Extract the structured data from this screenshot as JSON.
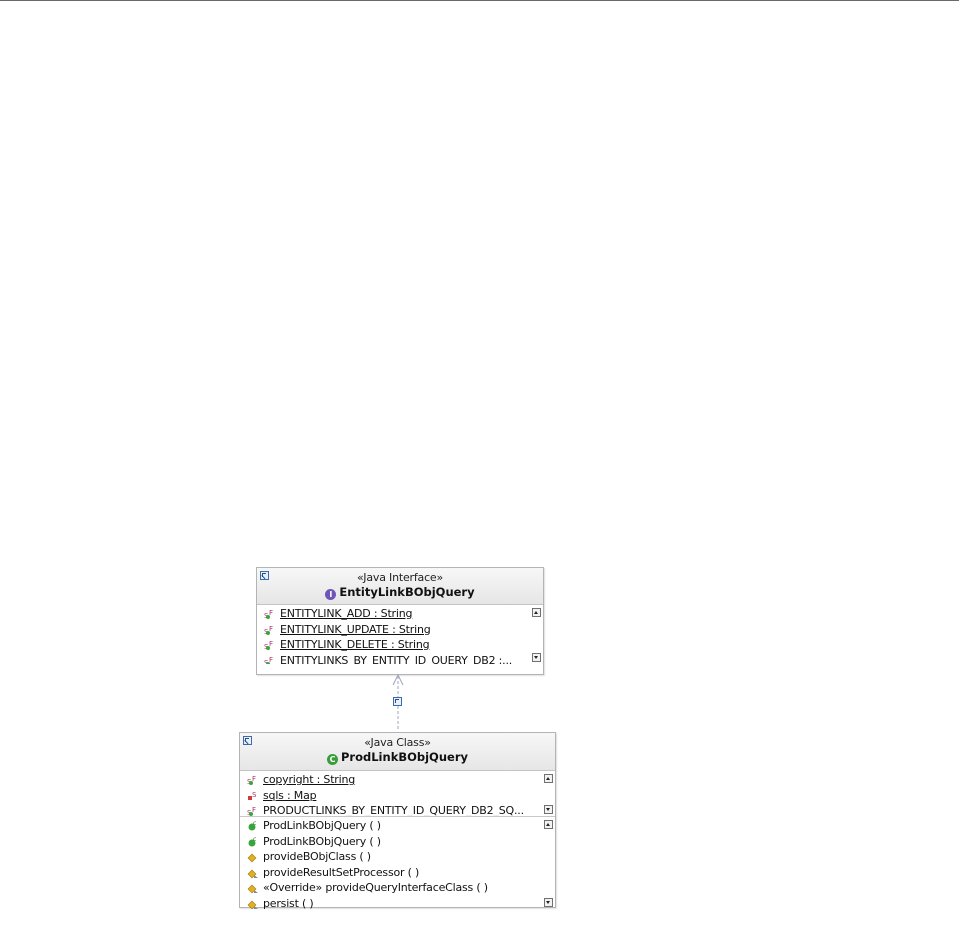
{
  "interface": {
    "stereotype": "«Java Interface»",
    "name": "EntityLinkBObjQuery",
    "badge": "I",
    "fields": [
      {
        "text": "ENTITYLINK_ADD : String",
        "icon": "static-final-field-icon",
        "static": true
      },
      {
        "text": "ENTITYLINK_UPDATE : String",
        "icon": "static-final-field-icon",
        "static": true
      },
      {
        "text": "ENTITYLINK_DELETE : String",
        "icon": "static-final-field-icon",
        "static": true
      },
      {
        "text": "ENTITYLINKS_BY_ENTITY_ID_QUERY_DB2 :...",
        "icon": "static-final-field-icon",
        "static": false
      }
    ]
  },
  "class": {
    "stereotype": "«Java Class»",
    "name": "ProdLinkBObjQuery",
    "badge": "C",
    "fields": [
      {
        "text": "copyright : String",
        "icon": "static-final-field-icon",
        "static": true
      },
      {
        "text": "sqls : Map",
        "icon": "private-static-field-icon",
        "static": true
      },
      {
        "text": "PRODUCTLINKS_BY_ENTITY_ID_QUERY_DB2_SQ...",
        "icon": "static-final-field-icon",
        "static": false
      }
    ],
    "methods": [
      {
        "text": "ProdLinkBObjQuery ( )",
        "icon": "public-constructor-icon"
      },
      {
        "text": "ProdLinkBObjQuery ( )",
        "icon": "public-constructor-icon"
      },
      {
        "text": "provideBObjClass ( )",
        "icon": "protected-method-icon"
      },
      {
        "text": "provideResultSetProcessor ( )",
        "icon": "protected-override-method-icon"
      },
      {
        "text": "«Override» provideQueryInterfaceClass ( )",
        "icon": "protected-override-method-icon"
      },
      {
        "text": "persist ( )",
        "icon": "protected-override-method-icon"
      }
    ]
  },
  "colors": {
    "interface_badge": "#6e55b8",
    "class_badge": "#3a9d3a",
    "header_bg": "#ececec",
    "border": "#b4b4b4",
    "relationship_line": "#9aa9bf"
  }
}
